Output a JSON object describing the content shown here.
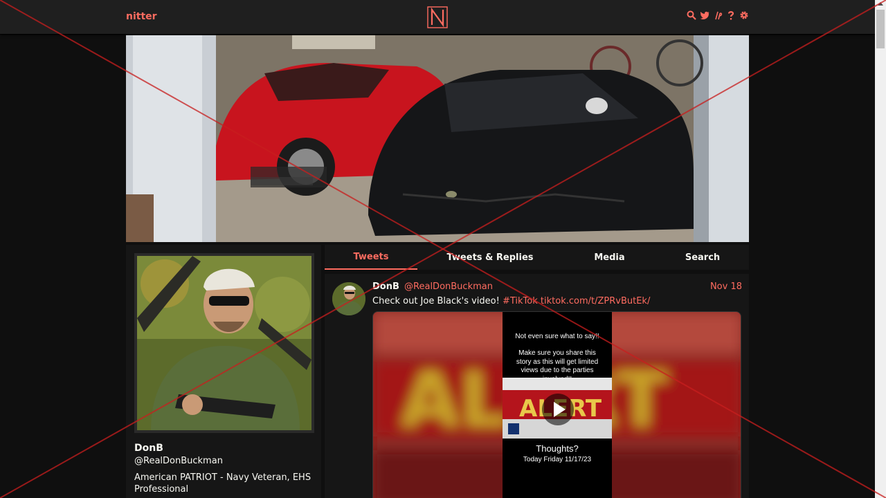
{
  "navbar": {
    "brand": "nitter",
    "logo_letter": "N",
    "icons": [
      "search-icon",
      "bird-icon",
      "rss-icon",
      "help-icon",
      "gear-icon"
    ]
  },
  "profile": {
    "name": "DonB",
    "handle": "@RealDonBuckman",
    "bio": "American PATRIOT - Navy Veteran, EHS Professional"
  },
  "tabs": [
    {
      "label": "Tweets",
      "active": true
    },
    {
      "label": "Tweets & Replies",
      "active": false
    },
    {
      "label": "Media",
      "active": false
    },
    {
      "label": "Search",
      "active": false
    }
  ],
  "tweet": {
    "name": "DonB",
    "username": "@RealDonBuckman",
    "date": "Nov 18",
    "text": "Check out Joe Black's video!",
    "hashtag": "#TikTok",
    "link": "tiktok.com/t/ZPRvButEk/",
    "media": {
      "line1": "Not even sure what to say!!",
      "line2": "Make sure you share this story as this will get limited views due to the parties involved!!",
      "thumb_text": "ALERT",
      "thoughts": "Thoughts?",
      "date_line": "Today Friday 11/17/23"
    }
  },
  "colors": {
    "accent": "#ff6c60",
    "background": "#0f0f0f",
    "panel": "#161616",
    "navbar": "#1f1f1f"
  }
}
